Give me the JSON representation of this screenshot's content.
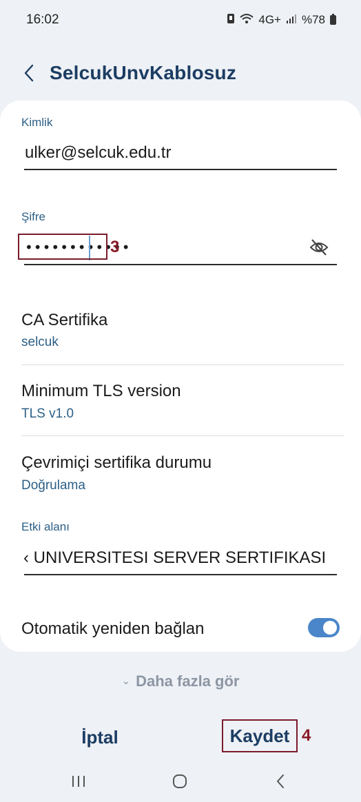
{
  "status_bar": {
    "time": "16:02",
    "network": "4G+",
    "battery_text": "%78"
  },
  "header": {
    "title": "SelcukUnvKablosuz"
  },
  "form": {
    "identity": {
      "label": "Kimlik",
      "value": "ulker@selcuk.edu.tr"
    },
    "password": {
      "label": "Şifre",
      "value": "••••••••••••"
    },
    "ca_certificate": {
      "title": "CA Sertifika",
      "value": "selcuk"
    },
    "min_tls": {
      "title": "Minimum TLS version",
      "value": "TLS v1.0"
    },
    "online_cert_status": {
      "title": "Çevrimiçi sertifika durumu",
      "value": "Doğrulama"
    },
    "domain": {
      "label": "Etki alanı",
      "value": "‹ UNIVERSITESI SERVER SERTIFIKASI"
    },
    "auto_reconnect": {
      "label": "Otomatik yeniden bağlan",
      "enabled": true
    }
  },
  "more": {
    "label": "Daha fazla gör"
  },
  "actions": {
    "cancel_label": "İptal",
    "save_label": "Kaydet"
  },
  "annotations": {
    "password_step": "3",
    "save_step": "4"
  },
  "colors": {
    "accent": "#2c5f86",
    "title": "#1c3d63",
    "toggle_on": "#4a86c9",
    "annotation": "#7b1a2a"
  },
  "icons": {
    "back": "chevron-left-icon",
    "password_visibility": "eye-off-icon",
    "nav_recent": "recent-apps-icon",
    "nav_home": "home-icon",
    "nav_back": "back-icon"
  }
}
